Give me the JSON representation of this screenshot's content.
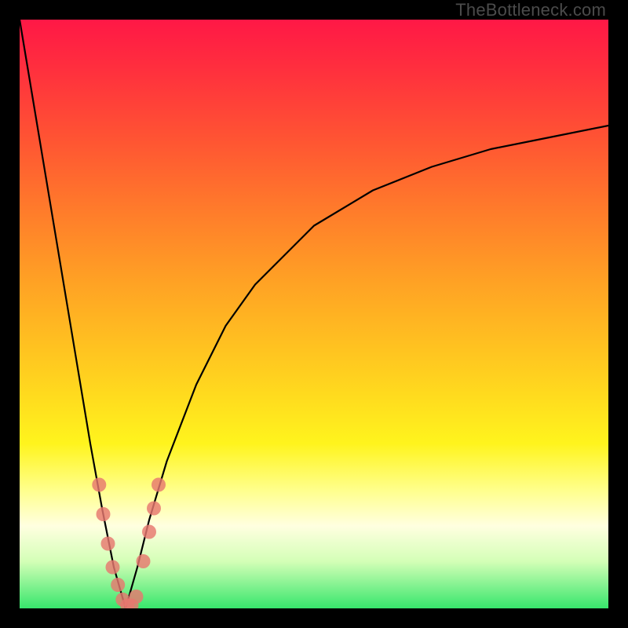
{
  "watermark": "TheBottleneck.com",
  "colors": {
    "frame": "#000000",
    "curve": "#000000",
    "marker_fill": "#e6776f",
    "marker_alpha": 0.82
  },
  "chart_data": {
    "type": "line",
    "title": "",
    "xlabel": "",
    "ylabel": "",
    "xlim": [
      0,
      100
    ],
    "ylim": [
      0,
      100
    ],
    "grid": false,
    "legend": false,
    "series": [
      {
        "name": "bottleneck_curve",
        "note": "V-shaped curve; minimum near x≈18 (y≈0); left branch steep to top-left corner, right branch rises asymptotically toward ~y≈82 at x=100",
        "x": [
          0,
          2,
          4,
          6,
          8,
          10,
          12,
          14,
          16,
          18,
          20,
          22,
          25,
          30,
          35,
          40,
          50,
          60,
          70,
          80,
          90,
          100
        ],
        "y": [
          100,
          88,
          76,
          64,
          52,
          40,
          28,
          17,
          7,
          0,
          7,
          15,
          25,
          38,
          48,
          55,
          65,
          71,
          75,
          78,
          80,
          82
        ]
      }
    ],
    "markers": {
      "name": "highlighted_points",
      "shape": "circle",
      "radius_px": 9,
      "points": [
        {
          "x": 13.5,
          "y": 21
        },
        {
          "x": 14.2,
          "y": 16
        },
        {
          "x": 15.0,
          "y": 11
        },
        {
          "x": 15.8,
          "y": 7
        },
        {
          "x": 16.7,
          "y": 4
        },
        {
          "x": 17.5,
          "y": 1.5
        },
        {
          "x": 18.3,
          "y": 0.5
        },
        {
          "x": 19.0,
          "y": 0.5
        },
        {
          "x": 19.8,
          "y": 2
        },
        {
          "x": 21.0,
          "y": 8
        },
        {
          "x": 22.0,
          "y": 13
        },
        {
          "x": 22.8,
          "y": 17
        },
        {
          "x": 23.6,
          "y": 21
        }
      ]
    }
  }
}
